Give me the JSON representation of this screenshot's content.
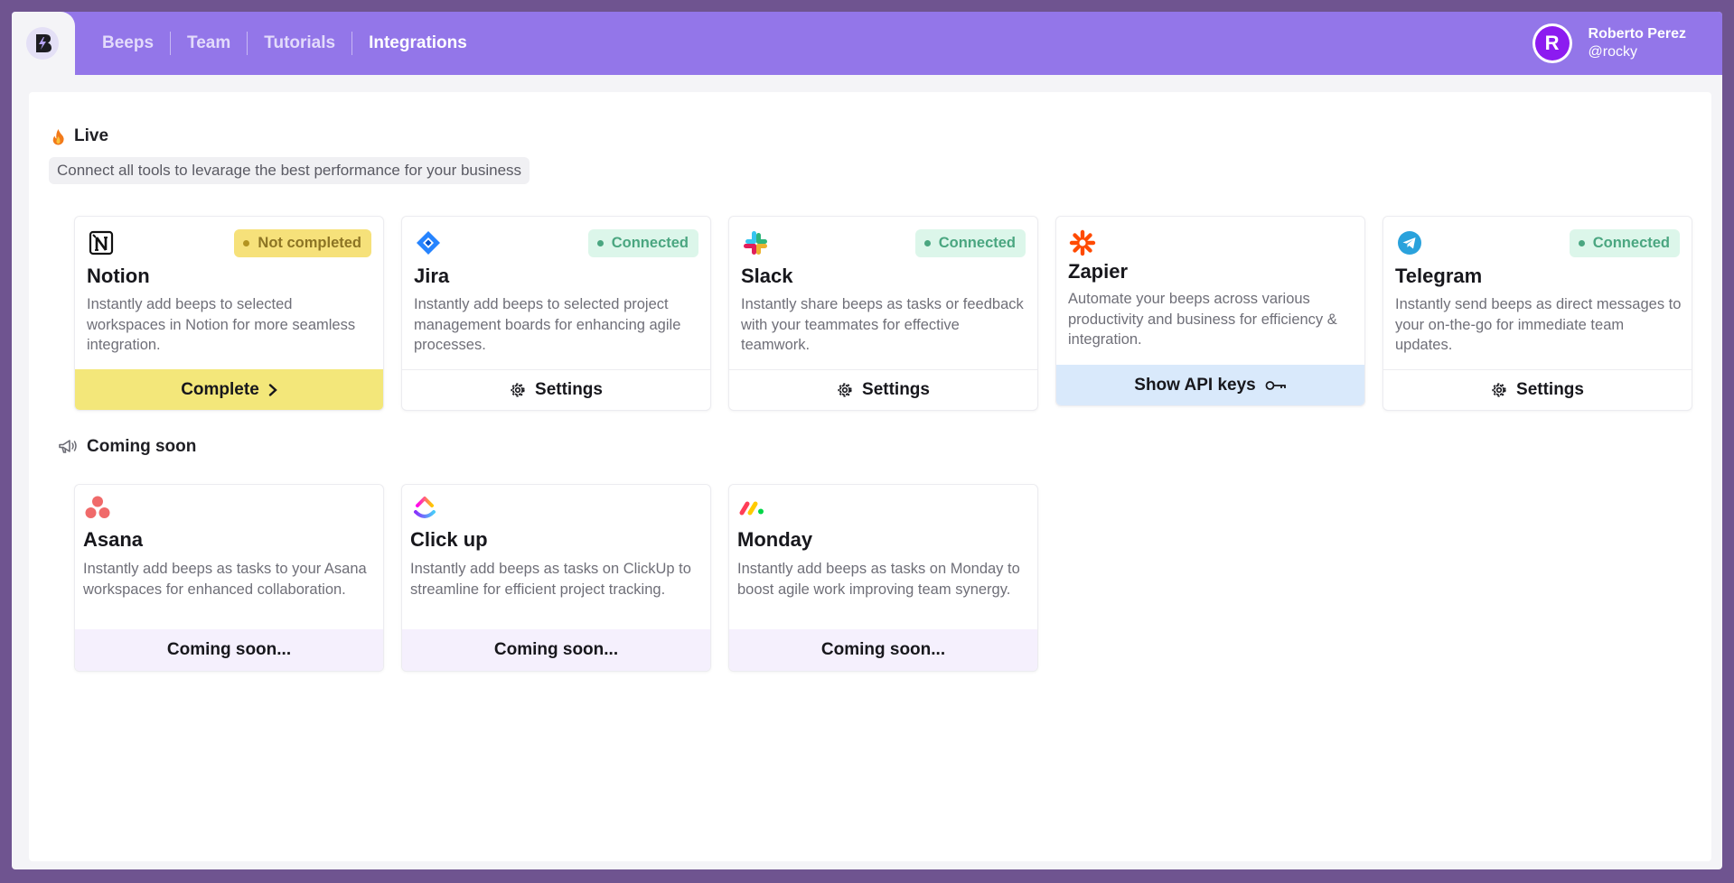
{
  "nav": {
    "items": [
      {
        "label": "Beeps",
        "active": false
      },
      {
        "label": "Team",
        "active": false
      },
      {
        "label": "Tutorials",
        "active": false
      },
      {
        "label": "Integrations",
        "active": true
      }
    ]
  },
  "user": {
    "name": "Roberto Perez",
    "handle": "@rocky",
    "avatar_letter": "R"
  },
  "live": {
    "title": "Live",
    "subtitle": "Connect all tools to levarage the best performance for your business",
    "cards": [
      {
        "name": "Notion",
        "icon": "notion-icon",
        "status": "Not completed",
        "description": "Instantly add beeps to selected workspaces in Notion for more seamless integration.",
        "button": "Complete"
      },
      {
        "name": "Jira",
        "icon": "jira-icon",
        "status": "Connected",
        "description": "Instantly add beeps to selected project management boards for enhancing agile processes.",
        "button": "Settings"
      },
      {
        "name": "Slack",
        "icon": "slack-icon",
        "status": "Connected",
        "description": "Instantly share beeps as tasks or feedback with your teammates for effective teamwork.",
        "button": "Settings"
      },
      {
        "name": "Zapier",
        "icon": "zapier-icon",
        "status": "",
        "description": "Automate your beeps across various productivity and business for efficiency & integration.",
        "button": "Show API keys"
      },
      {
        "name": "Telegram",
        "icon": "telegram-icon",
        "status": "Connected",
        "description": "Instantly send beeps as direct messages to your on-the-go for immediate team updates.",
        "button": "Settings"
      }
    ]
  },
  "coming_soon": {
    "title": "Coming soon",
    "cards": [
      {
        "name": "Asana",
        "icon": "asana-icon",
        "description": "Instantly add beeps as tasks to your Asana workspaces for enhanced collaboration.",
        "button": "Coming soon..."
      },
      {
        "name": "Click up",
        "icon": "clickup-icon",
        "description": "Instantly add beeps as tasks on ClickUp to streamline for efficient project tracking.",
        "button": "Coming soon..."
      },
      {
        "name": "Monday",
        "icon": "monday-icon",
        "description": "Instantly add beeps as tasks on Monday to boost agile work improving team synergy.",
        "button": "Coming soon..."
      }
    ]
  },
  "colors": {
    "topbar": "#9376e9",
    "outer_background": "#6f5490",
    "badge_connected_bg": "#dcf6ea",
    "badge_warning_bg": "#f6e17a",
    "complete_button": "#f3e77a",
    "api_keys_button": "#d9e9fb",
    "coming_soon_button": "#f5f0fd"
  }
}
